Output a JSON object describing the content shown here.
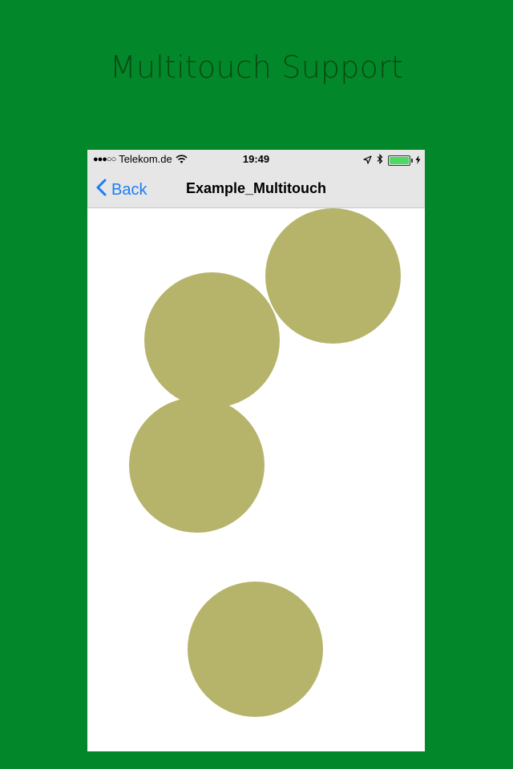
{
  "promo": {
    "title": "Multitouch Support"
  },
  "status_bar": {
    "signal_dots": "●●●○○",
    "carrier": "Telekom.de",
    "time": "19:49",
    "battery_level": 1.0
  },
  "nav_bar": {
    "back_label": "Back",
    "title": "Example_Multitouch"
  },
  "canvas": {
    "touch_count": 4,
    "circle_color": "#b6b46a"
  },
  "colors": {
    "background": "#02882b",
    "accent": "#1a7ef5",
    "battery": "#4cd964"
  },
  "icons": [
    "wifi-icon",
    "location-arrow-icon",
    "bluetooth-icon",
    "battery-icon",
    "charging-bolt-icon",
    "back-chevron-icon"
  ]
}
